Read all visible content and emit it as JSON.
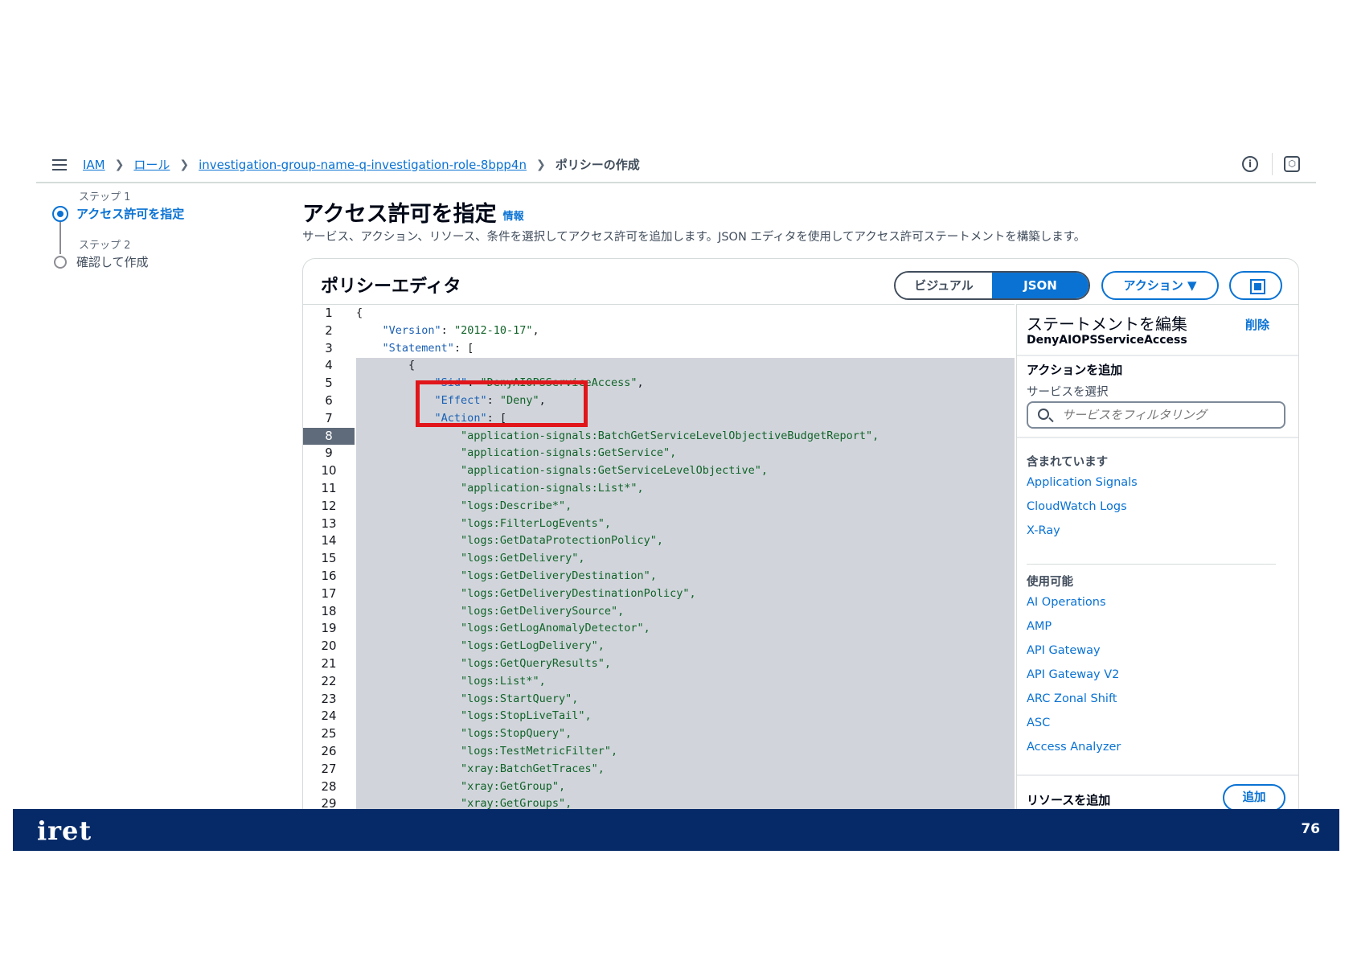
{
  "breadcrumb": {
    "items": [
      "IAM",
      "ロール",
      "investigation-group-name-q-investigation-role-8bpp4n"
    ],
    "current": "ポリシーの作成"
  },
  "topbar": {
    "info_icon": "i",
    "settings_icon": "⬡"
  },
  "steps": {
    "step1_label": "ステップ 1",
    "step1_name": "アクセス許可を指定",
    "step2_label": "ステップ 2",
    "step2_name": "確認して作成"
  },
  "header": {
    "title": "アクセス許可を指定",
    "info": "情報",
    "description": "サービス、アクション、リソース、条件を選択してアクセス許可を追加します。JSON エディタを使用してアクセス許可ステートメントを構築します。"
  },
  "editor": {
    "title": "ポリシーエディタ",
    "tab_visual": "ビジュアル",
    "tab_json": "JSON",
    "action_button": "アクション ▼",
    "current_line": 8,
    "line_numbers": [
      "1",
      "2",
      "3",
      "4",
      "5",
      "6",
      "7",
      "8",
      "9",
      "10",
      "11",
      "12",
      "13",
      "14",
      "15",
      "16",
      "17",
      "18",
      "19",
      "20",
      "21",
      "22",
      "23",
      "24",
      "25",
      "26",
      "27",
      "28",
      "29"
    ]
  },
  "code": {
    "l1": "{",
    "l2_key": "\"Version\"",
    "l2_val": "\"2012-10-17\"",
    "l3_key": "\"Statement\"",
    "l3_rest": ": [",
    "l4": "        {",
    "l5_key": "\"Sid\"",
    "l5_val": "\"DenyAIOPSServiceAccess\"",
    "l6_key": "\"Effect\"",
    "l6_val": "\"Deny\"",
    "l7_key": "\"Action\"",
    "l7_rest": ": [",
    "actions": [
      "\"application-signals:BatchGetServiceLevelObjectiveBudgetReport\",",
      "\"application-signals:GetService\",",
      "\"application-signals:GetServiceLevelObjective\",",
      "\"application-signals:List*\",",
      "\"logs:Describe*\",",
      "\"logs:FilterLogEvents\",",
      "\"logs:GetDataProtectionPolicy\",",
      "\"logs:GetDelivery\",",
      "\"logs:GetDeliveryDestination\",",
      "\"logs:GetDeliveryDestinationPolicy\",",
      "\"logs:GetDeliverySource\",",
      "\"logs:GetLogAnomalyDetector\",",
      "\"logs:GetLogDelivery\",",
      "\"logs:GetQueryResults\",",
      "\"logs:List*\",",
      "\"logs:StartQuery\",",
      "\"logs:StopLiveTail\",",
      "\"logs:StopQuery\",",
      "\"logs:TestMetricFilter\",",
      "\"xray:BatchGetTraces\",",
      "\"xray:GetGroup\",",
      "\"xray:GetGroups\","
    ]
  },
  "statement_panel": {
    "title": "ステートメントを編集",
    "sid": "DenyAIOPSServiceAccess",
    "delete": "削除",
    "add_action": "アクションを追加",
    "select_service": "サービスを選択",
    "filter_placeholder": "サービスをフィルタリング",
    "included_heading": "含まれています",
    "included": [
      "Application Signals",
      "CloudWatch Logs",
      "X-Ray"
    ],
    "available_heading": "使用可能",
    "available": [
      "AI Operations",
      "AMP",
      "API Gateway",
      "API Gateway V2",
      "ARC Zonal Shift",
      "ASC",
      "Access Analyzer"
    ],
    "add_resource": "リソースを追加",
    "add_button": "追加"
  },
  "footer": {
    "logo": "iret",
    "page_number": "76"
  },
  "colors": {
    "accent": "#0972d3",
    "footer_bg": "#062a68",
    "highlight_box": "#e0161b",
    "selection": "#d1d5db"
  }
}
